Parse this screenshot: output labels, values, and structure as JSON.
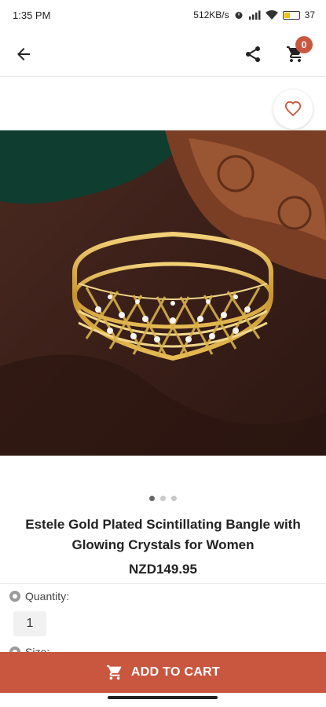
{
  "status_bar": {
    "time": "1:35 PM",
    "network_speed": "512KB/s",
    "battery": "37"
  },
  "app_bar": {
    "cart_count": "0"
  },
  "icons": {
    "back": "arrow-left-icon",
    "share": "share-icon",
    "cart": "cart-icon",
    "wishlist": "heart-icon"
  },
  "colors": {
    "accent": "#c9573f",
    "gold": "#d9b24a"
  },
  "product": {
    "title": "Estele Gold Plated Scintillating Bangle with Glowing Crystals for Women",
    "price": "NZD149.95",
    "image_count": 3,
    "active_image": 1
  },
  "options": {
    "quantity_label": "Quantity:",
    "quantity_value": "1",
    "size_label": "Size:"
  },
  "actions": {
    "add_to_cart": "ADD TO CART"
  }
}
